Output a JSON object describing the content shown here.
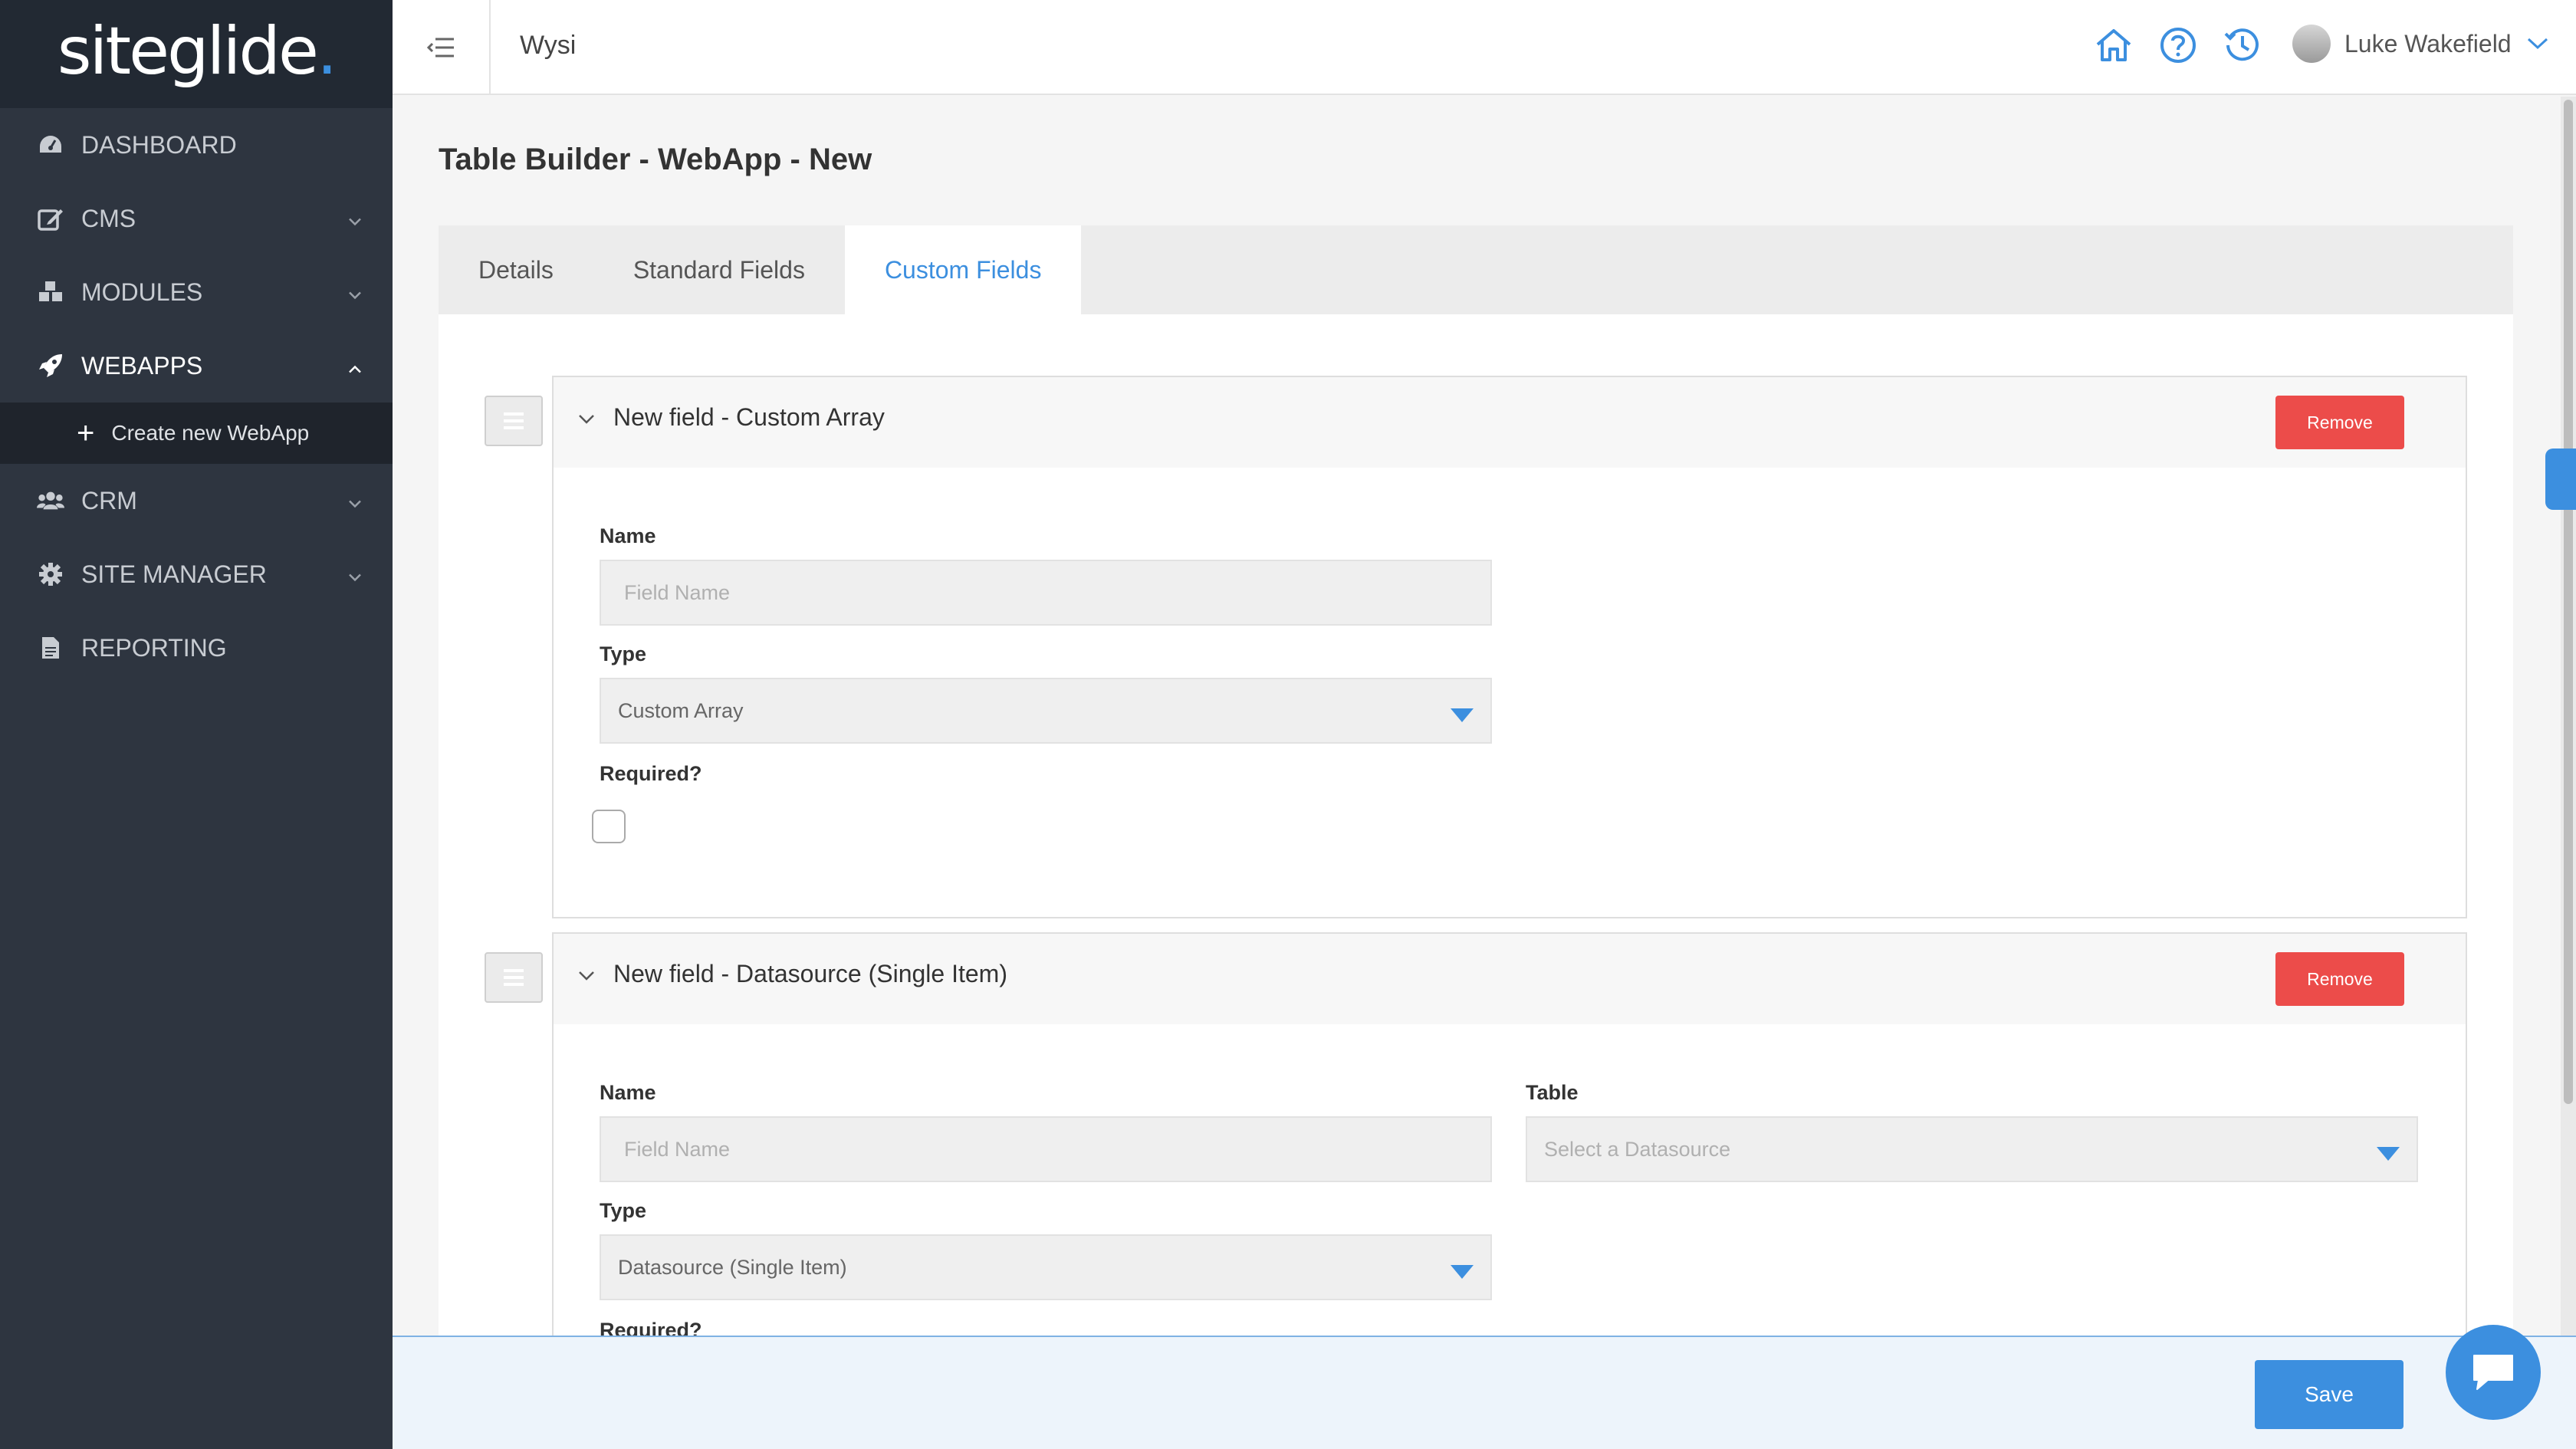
{
  "sidebar": {
    "logo_main": "siteglide",
    "logo_dot": ".",
    "items": [
      {
        "label": "DASHBOARD",
        "icon": "gauge-icon"
      },
      {
        "label": "CMS",
        "icon": "edit-icon"
      },
      {
        "label": "MODULES",
        "icon": "cubes-icon"
      },
      {
        "label": "WEBAPPS",
        "icon": "rocket-icon"
      },
      {
        "label": "CRM",
        "icon": "users-icon"
      },
      {
        "label": "SITE MANAGER",
        "icon": "gear-icon"
      },
      {
        "label": "REPORTING",
        "icon": "file-icon"
      }
    ],
    "sub_item": {
      "label": "Create new WebApp",
      "icon": "plus-icon"
    }
  },
  "topbar": {
    "site_name": "Wysi",
    "user_name": "Luke Wakefield"
  },
  "page": {
    "title": "Table Builder - WebApp - New",
    "tabs": [
      "Details",
      "Standard Fields",
      "Custom Fields"
    ],
    "active_tab": "Custom Fields"
  },
  "fields": [
    {
      "title": "New field - Custom Array",
      "remove_label": "Remove",
      "name_label": "Name",
      "name_placeholder": "Field Name",
      "type_label": "Type",
      "type_value": "Custom Array",
      "required_label": "Required?"
    },
    {
      "title": "New field - Datasource (Single Item)",
      "remove_label": "Remove",
      "name_label": "Name",
      "name_placeholder": "Field Name",
      "table_label": "Table",
      "table_placeholder": "Select a Datasource",
      "type_label": "Type",
      "type_value": "Datasource (Single Item)",
      "required_label": "Required?"
    }
  ],
  "footer": {
    "save_label": "Save"
  },
  "colors": {
    "accent": "#3c8fdf",
    "danger": "#ec4c4a",
    "sidebar": "#2e3540"
  }
}
